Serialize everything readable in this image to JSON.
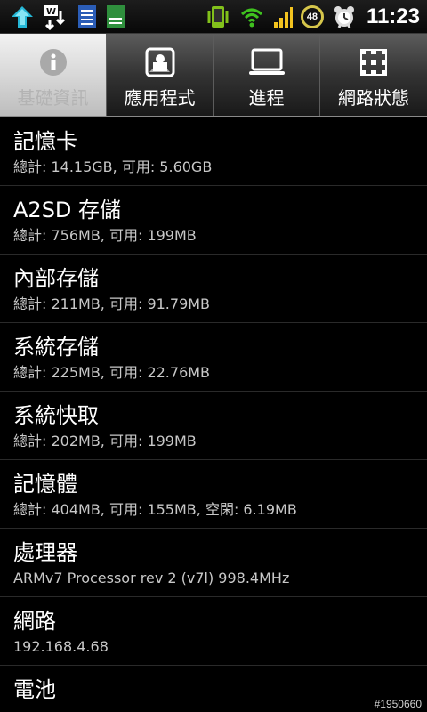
{
  "status_bar": {
    "time": "11:23",
    "battery": "48",
    "icons": [
      "upload-arrow-icon",
      "w-download-icon",
      "blue-document-icon",
      "green-document-icon",
      "phone-vibrate-icon",
      "wifi-icon",
      "signal-icon",
      "battery-icon",
      "alarm-clock-icon"
    ]
  },
  "tabs": [
    {
      "label": "基礎資訊",
      "icon": "info-icon",
      "active": true
    },
    {
      "label": "應用程式",
      "icon": "apps-icon",
      "active": false
    },
    {
      "label": "進程",
      "icon": "process-icon",
      "active": false
    },
    {
      "label": "網路狀態",
      "icon": "network-icon",
      "active": false
    }
  ],
  "list": {
    "items": [
      {
        "title": "記憶卡",
        "subtitle": "總計: 14.15GB, 可用: 5.60GB"
      },
      {
        "title": "A2SD 存儲",
        "subtitle": "總計: 756MB, 可用: 199MB"
      },
      {
        "title": "內部存儲",
        "subtitle": "總計: 211MB, 可用: 91.79MB"
      },
      {
        "title": "系統存儲",
        "subtitle": "總計: 225MB, 可用: 22.76MB"
      },
      {
        "title": "系統快取",
        "subtitle": "總計: 202MB, 可用: 199MB"
      },
      {
        "title": "記憶體",
        "subtitle": "總計: 404MB, 可用: 155MB, 空閑: 6.19MB"
      },
      {
        "title": "處理器",
        "subtitle": "ARMv7 Processor rev 2 (v7l)  998.4MHz"
      },
      {
        "title": "網路",
        "subtitle": "192.168.4.68"
      },
      {
        "title": "電池",
        "subtitle": ""
      }
    ]
  },
  "watermark": "#1950660"
}
